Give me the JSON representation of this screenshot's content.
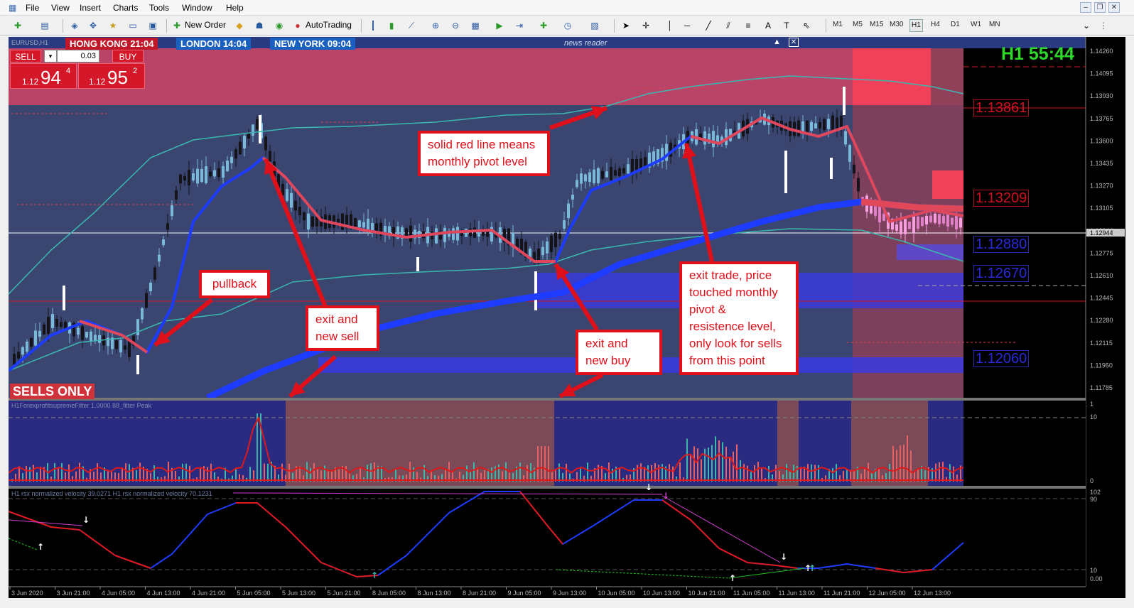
{
  "menu": [
    "File",
    "View",
    "Insert",
    "Charts",
    "Tools",
    "Window",
    "Help"
  ],
  "toolbar": {
    "new_order": "New Order",
    "autotrading": "AutoTrading",
    "timeframes": [
      "M1",
      "M5",
      "M15",
      "M30",
      "H1",
      "H4",
      "D1",
      "W1",
      "MN"
    ],
    "active_timeframe": "H1"
  },
  "chart": {
    "symbol": "EURUSD,H1",
    "news_reader": "news reader",
    "sessions": {
      "hong_kong": "HONG KONG 21:04",
      "london": "LONDON  14:04",
      "new_york": "NEW YORK  09:04"
    },
    "trade_panel": {
      "sell_label": "SELL",
      "buy_label": "BUY",
      "lot": "0.03",
      "sell_prefix": "1.12",
      "sell_big": "94",
      "sell_sup": "4",
      "buy_prefix": "1.12",
      "buy_big": "95",
      "buy_sup": "2"
    },
    "timer": "H1 55:44",
    "sells_only": "SELLS ONLY",
    "levels": {
      "l1": "1.13861",
      "l2": "1.13209",
      "l3": "1.12880",
      "l4": "1.12670",
      "l5": "1.12060"
    },
    "price_axis": [
      "1.14260",
      "1.14095",
      "1.13930",
      "1.13765",
      "1.13600",
      "1.13435",
      "1.13270",
      "1.13105",
      "1.12944",
      "1.12775",
      "1.12610",
      "1.12445",
      "1.12280",
      "1.12115",
      "1.11950",
      "1.11785"
    ],
    "current_price": "1.12944",
    "time_axis": [
      "3 Jun 2020",
      "3 Jun 21:00",
      "4 Jun 05:00",
      "4 Jun 13:00",
      "4 Jun 21:00",
      "5 Jun 05:00",
      "5 Jun 13:00",
      "5 Jun 21:00",
      "8 Jun 05:00",
      "8 Jun 13:00",
      "8 Jun 21:00",
      "9 Jun 05:00",
      "9 Jun 13:00",
      "10 Jun 05:00",
      "10 Jun 13:00",
      "10 Jun 21:00",
      "11 Jun 05:00",
      "11 Jun 13:00",
      "11 Jun 21:00",
      "12 Jun 05:00",
      "12 Jun 13:00"
    ],
    "indicator1": {
      "title": "H1ForexprofitsupremeFilter 1.0000  88_filter  Peak",
      "axis": [
        "1",
        "10",
        "0"
      ]
    },
    "indicator2": {
      "title": "H1 rsx normalized velocity 39.0271  H1 rsx normalized velocity 70.1231",
      "axis": [
        "102",
        "90",
        "10",
        "0.00"
      ]
    }
  },
  "annotations": {
    "monthly_pivot": "solid red line means\nmonthly pivot level",
    "pullback": "pullback",
    "exit_sell": "exit and\nnew sell",
    "exit_buy": "exit and\nnew buy",
    "exit_trade": "exit trade, price\ntouched monthly\npivot &\nresistence level,\nonly look for sells\nfrom this point"
  },
  "colors": {
    "annotation_red": "#e0101a",
    "chart_bg_blue": "#252a6a",
    "bull_candle": "#7ab8d8",
    "bear_candle": "#141418",
    "timer_green": "#2ed82a"
  }
}
